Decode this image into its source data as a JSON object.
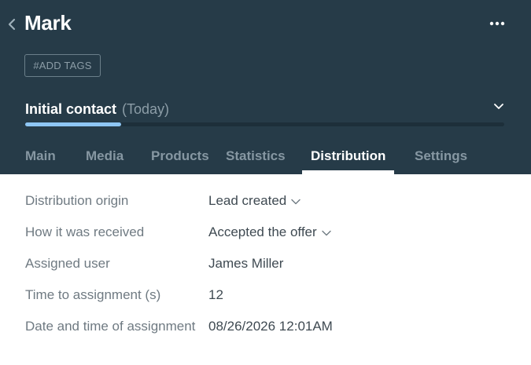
{
  "header": {
    "title": "Mark",
    "add_tags_label": "#ADD TAGS",
    "status": {
      "name": "Initial contact",
      "date": "(Today)",
      "progress_fraction": 0.2
    },
    "icons": {
      "back": "chevron-left-icon",
      "more": "more-horizontal-icon",
      "status_toggle": "chevron-down-icon"
    }
  },
  "tabs": [
    {
      "label": "Main"
    },
    {
      "label": "Media"
    },
    {
      "label": "Products"
    },
    {
      "label": "Statistics"
    },
    {
      "label": "Distribution",
      "active": true
    },
    {
      "label": "Settings"
    }
  ],
  "fields": [
    {
      "label": "Distribution origin",
      "value": "Lead created",
      "dropdown": true
    },
    {
      "label": "How it was received",
      "value": "Accepted the offer",
      "dropdown": true
    },
    {
      "label": "Assigned user",
      "value": "James Miller",
      "dropdown": false
    },
    {
      "label": "Time to assignment (s)",
      "value": "12",
      "dropdown": false
    },
    {
      "label": "Date and time of assignment",
      "value": "08/26/2026 12:01AM",
      "dropdown": false
    }
  ],
  "colors": {
    "header_bg": "#263b48",
    "progress_fill": "#8ec6f4",
    "tab_active": "#ffffff",
    "tab_inactive": "#8697a2"
  }
}
